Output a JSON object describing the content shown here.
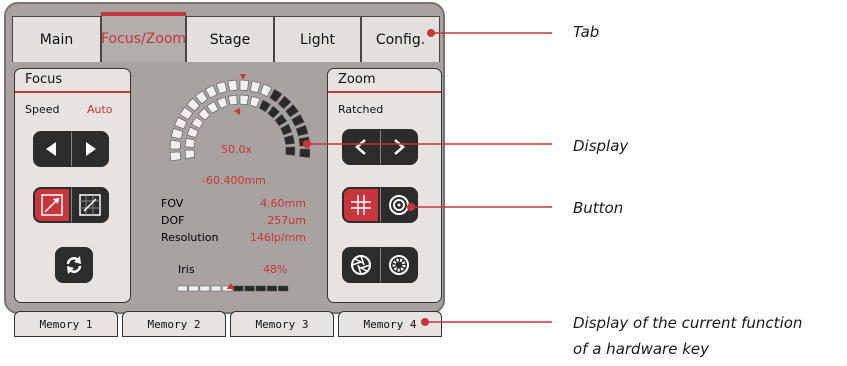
{
  "tabs": [
    {
      "label": "Main"
    },
    {
      "label": "Focus/Zoom",
      "active": true
    },
    {
      "label": "Stage"
    },
    {
      "label": "Light"
    },
    {
      "label": "Config."
    }
  ],
  "focus": {
    "title": "Focus",
    "speed_label": "Speed",
    "speed_value": "Auto"
  },
  "zoom": {
    "title": "Zoom",
    "mode": "Ratched"
  },
  "display": {
    "magnification": "50.0x",
    "position": "-60.400mm",
    "stats": [
      {
        "label": "FOV",
        "value": "4.60mm"
      },
      {
        "label": "DOF",
        "value": "257um"
      },
      {
        "label": "Resolution",
        "value": "146lp/mm"
      }
    ],
    "iris_label": "Iris",
    "iris_value": "48%"
  },
  "memory": [
    {
      "label": "Memory 1"
    },
    {
      "label": "Memory 2"
    },
    {
      "label": "Memory 3"
    },
    {
      "label": "Memory 4"
    }
  ],
  "callouts": {
    "tab": "Tab",
    "display": "Display",
    "button": "Button",
    "hardware_key_line1": "Display of the current function",
    "hardware_key_line2": "of a hardware key"
  },
  "colors": {
    "accent": "#c8353c",
    "panel": "#e6e3e0",
    "device": "#a8a3a0"
  }
}
